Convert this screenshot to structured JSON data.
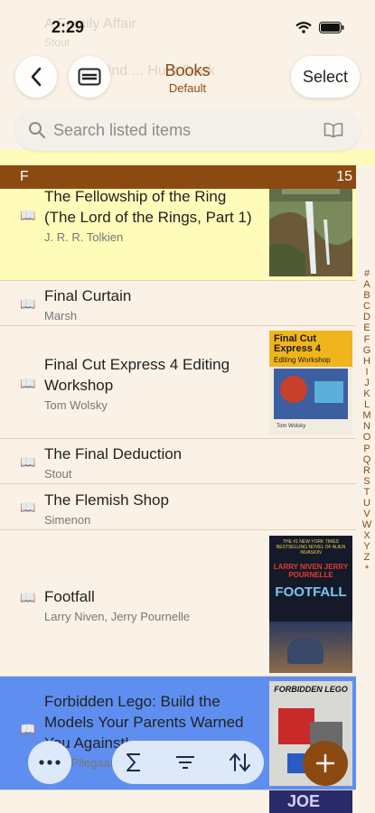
{
  "status": {
    "time": "2:29"
  },
  "ghost_rows": [
    "A Family Affair",
    "Stout",
    "Find ... Hunt Book"
  ],
  "nav": {
    "title": "Books",
    "subtitle": "Default",
    "select_label": "Select"
  },
  "search": {
    "placeholder": "Search listed items"
  },
  "section": {
    "letter": "F",
    "count": "15"
  },
  "books": [
    {
      "title": "The Fellowship of the Ring (The Lord of the Rings, Part 1)",
      "author": "J. R. R. Tolkien"
    },
    {
      "title": "Final Curtain",
      "author": "Marsh"
    },
    {
      "title": "Final Cut Express 4 Editing Workshop",
      "author": "Tom Wolsky"
    },
    {
      "title": "The Final Deduction",
      "author": "Stout"
    },
    {
      "title": "The Flemish Shop",
      "author": "Simenon"
    },
    {
      "title": "Footfall",
      "author": "Larry Niven, Jerry Pournelle"
    },
    {
      "title": "Forbidden Lego: Build the Models Your Parents Warned You Against!",
      "author": "Ulrik Pilegaard, Mike Dooley"
    }
  ],
  "covers": {
    "final_cut_title": "Final Cut Express 4",
    "final_cut_sub": "Editing Workshop",
    "final_cut_author": "Tom Wolsky",
    "footfall_top": "THE #1 NEW YORK TIMES BESTSELLING NOVEL OF ALIEN INVASION",
    "footfall_authors": "LARRY NIVEN JERRY POURNELLE",
    "footfall_title": "FOOTFALL",
    "lego_title": "FORBIDDEN LEGO",
    "partial_title": "JOE"
  },
  "alphabet": [
    "#",
    "A",
    "B",
    "C",
    "D",
    "E",
    "F",
    "G",
    "H",
    "I",
    "J",
    "K",
    "L",
    "M",
    "N",
    "O",
    "P",
    "Q",
    "R",
    "S",
    "T",
    "U",
    "V",
    "W",
    "X",
    "Y",
    "Z",
    "*"
  ],
  "colors": {
    "accent": "#8b4a12",
    "highlight": "#fffbb8",
    "selected": "#5e8ff0"
  }
}
